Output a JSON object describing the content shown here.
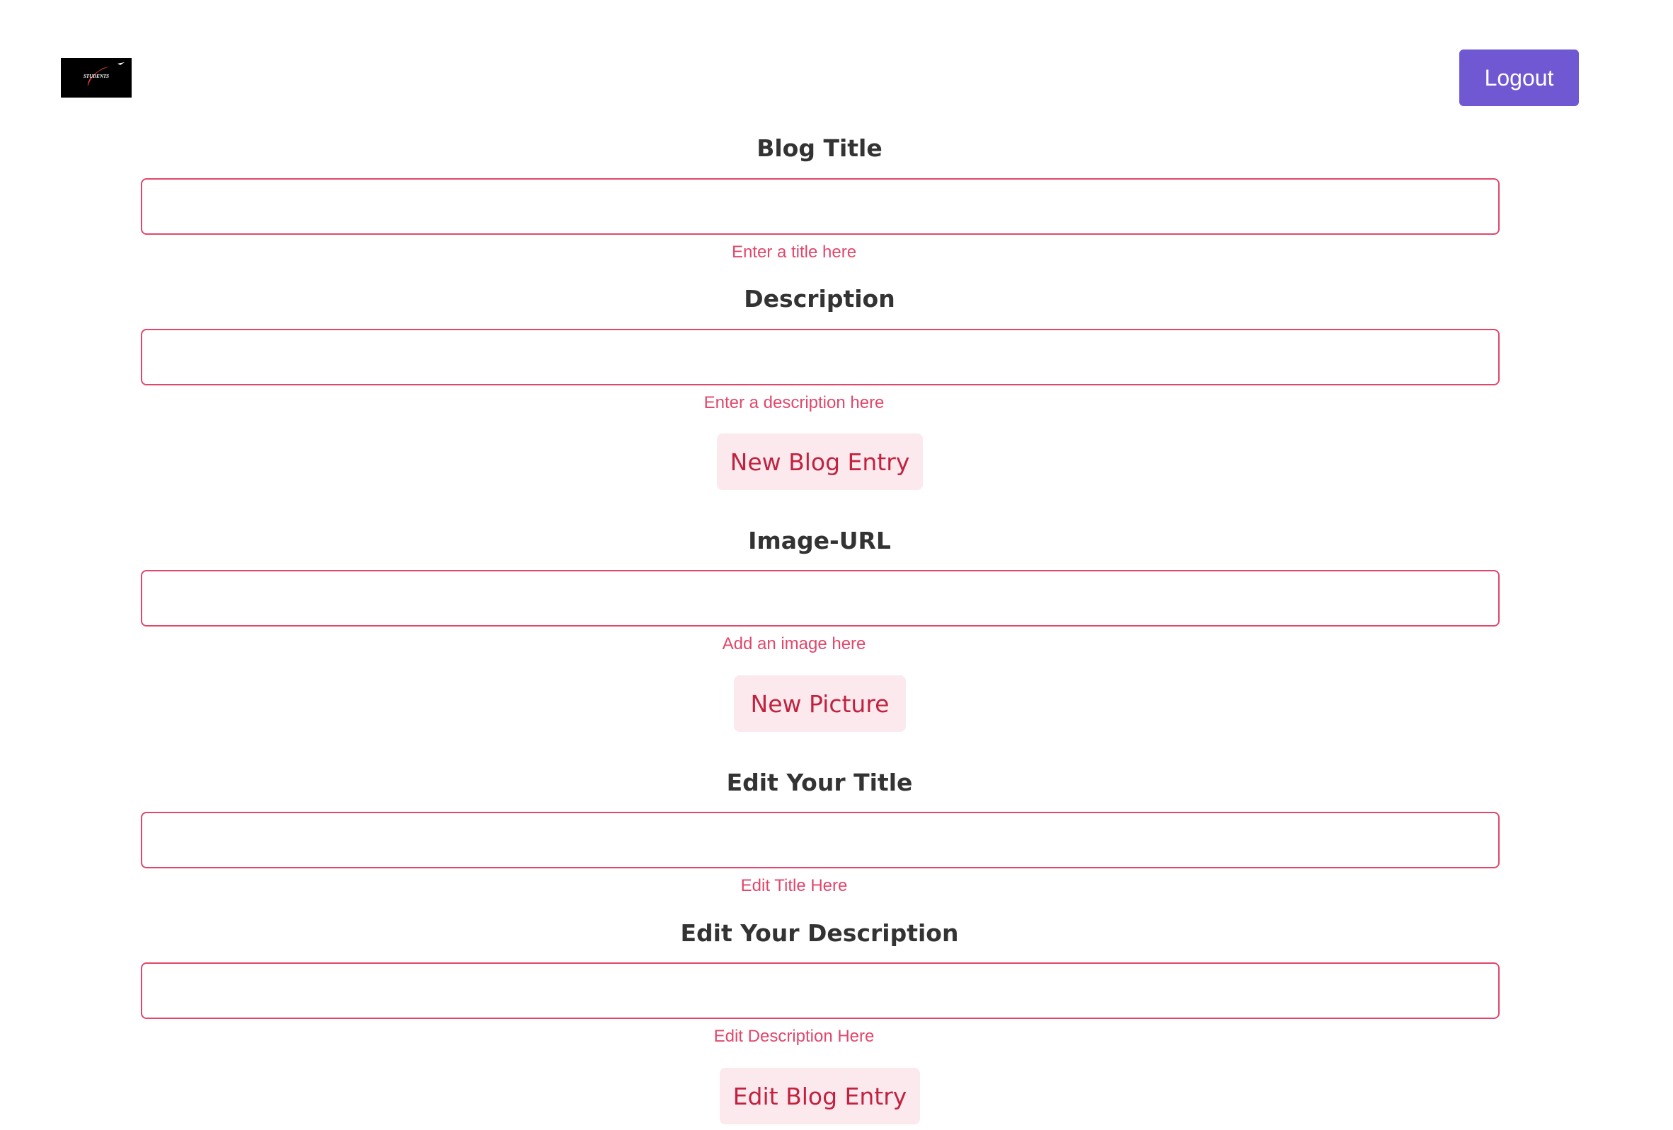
{
  "header": {
    "logo_text": "STUDENTS",
    "logout_label": "Logout"
  },
  "form": {
    "blog_title": {
      "label": "Blog Title",
      "value": "",
      "helper": "Enter a title here"
    },
    "description": {
      "label": "Description",
      "value": "",
      "helper": "Enter a description here"
    },
    "new_blog_entry_label": "New Blog Entry",
    "image_url": {
      "label": "Image-URL",
      "value": "",
      "helper": "Add an image here"
    },
    "new_picture_label": "New Picture",
    "edit_title": {
      "label": "Edit Your Title",
      "value": "",
      "helper": "Edit Title Here"
    },
    "edit_description": {
      "label": "Edit Your Description",
      "value": "",
      "helper": "Edit Description Here"
    },
    "edit_blog_entry_label": "Edit Blog Entry"
  },
  "colors": {
    "accent": "#7158d3",
    "error": "#e0476b",
    "button_bg": "#fbe9ee",
    "button_text": "#c0223f"
  }
}
